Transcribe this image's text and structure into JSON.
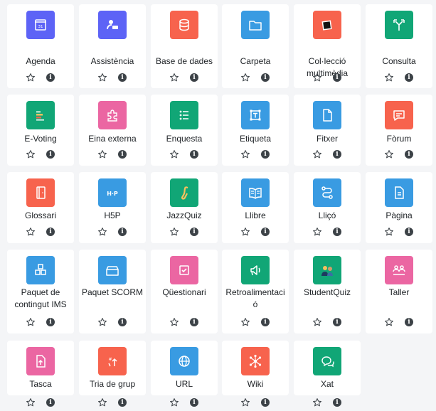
{
  "colors": {
    "admin": "#5d63f6",
    "content": "#399be2",
    "collaboration": "#f7634d",
    "communication": "#11a676",
    "assessment": "#eb66a2",
    "interactive": "#1d3a5f",
    "page_bg": "#f4f5f7"
  },
  "modules": [
    {
      "name": "Agenda",
      "icon": "calendar-icon",
      "color": "#5d63f6"
    },
    {
      "name": "Assistència",
      "icon": "attendance-icon",
      "color": "#5d63f6"
    },
    {
      "name": "Base de dades",
      "icon": "database-icon",
      "color": "#f7634d"
    },
    {
      "name": "Carpeta",
      "icon": "folder-icon",
      "color": "#399be2"
    },
    {
      "name": "Col·lecció multimèdia",
      "icon": "media-collection-icon",
      "color": "#f7634d"
    },
    {
      "name": "Consulta",
      "icon": "choice-icon",
      "color": "#11a676"
    },
    {
      "name": "E-Voting",
      "icon": "evoting-icon",
      "color": "#11a676"
    },
    {
      "name": "Eina externa",
      "icon": "puzzle-icon",
      "color": "#eb66a2"
    },
    {
      "name": "Enquesta",
      "icon": "survey-icon",
      "color": "#11a676"
    },
    {
      "name": "Etiqueta",
      "icon": "label-icon",
      "color": "#399be2"
    },
    {
      "name": "Fitxer",
      "icon": "file-icon",
      "color": "#399be2"
    },
    {
      "name": "Fòrum",
      "icon": "forum-icon",
      "color": "#f7634d"
    },
    {
      "name": "Glossari",
      "icon": "glossary-icon",
      "color": "#f7634d"
    },
    {
      "name": "H5P",
      "icon": "h5p-icon",
      "color": "#399be2"
    },
    {
      "name": "JazzQuiz",
      "icon": "saxophone-icon",
      "color": "#11a676"
    },
    {
      "name": "Llibre",
      "icon": "book-icon",
      "color": "#399be2"
    },
    {
      "name": "Lliçó",
      "icon": "lesson-icon",
      "color": "#399be2"
    },
    {
      "name": "Pàgina",
      "icon": "page-icon",
      "color": "#399be2"
    },
    {
      "name": "Paquet de contingut IMS",
      "icon": "ims-package-icon",
      "color": "#399be2"
    },
    {
      "name": "Paquet SCORM",
      "icon": "scorm-icon",
      "color": "#399be2"
    },
    {
      "name": "Qüestionari",
      "icon": "quiz-icon",
      "color": "#eb66a2"
    },
    {
      "name": "Retroalimentació",
      "icon": "feedback-icon",
      "color": "#11a676"
    },
    {
      "name": "StudentQuiz",
      "icon": "studentquiz-icon",
      "color": "#11a676"
    },
    {
      "name": "Taller",
      "icon": "workshop-icon",
      "color": "#eb66a2"
    },
    {
      "name": "Tasca",
      "icon": "assignment-icon",
      "color": "#eb66a2"
    },
    {
      "name": "Tria de grup",
      "icon": "group-choice-icon",
      "color": "#f7634d"
    },
    {
      "name": "URL",
      "icon": "url-icon",
      "color": "#399be2"
    },
    {
      "name": "Wiki",
      "icon": "wiki-icon",
      "color": "#f7634d"
    },
    {
      "name": "Xat",
      "icon": "chat-icon",
      "color": "#11a676"
    }
  ]
}
